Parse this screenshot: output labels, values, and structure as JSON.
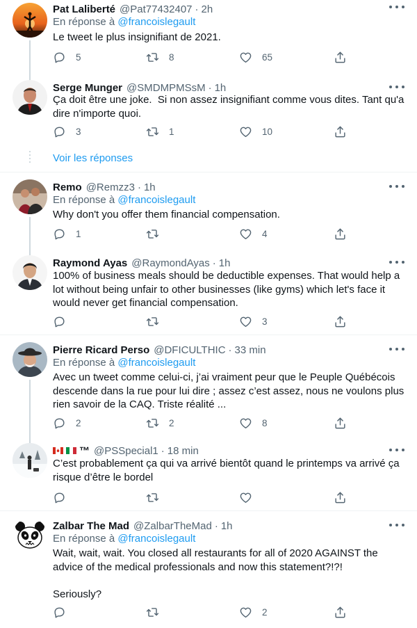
{
  "tweets": [
    {
      "name": "Pat Laliberté",
      "handle": "@Pat77432407",
      "dot": "·",
      "time": "2h",
      "reply_prefix": "En réponse à",
      "reply_mention": "@francoislegault",
      "text": "Le tweet le plus insignifiant de 2021.",
      "replies": "5",
      "retweets": "8",
      "likes": "65"
    },
    {
      "name": "Serge Munger",
      "handle": "@SMDMPMSsM",
      "dot": "·",
      "time": "1h",
      "text": "Ça doit être une joke.  Si non assez insignifiant comme vous dites. Tant qu'a dire n'importe quoi.",
      "replies": "3",
      "retweets": "1",
      "likes": "10"
    },
    {
      "name": "Remo",
      "handle": "@Remzz3",
      "dot": "·",
      "time": "1h",
      "reply_prefix": "En réponse à",
      "reply_mention": "@francoislegault",
      "text": "Why don't you offer them financial compensation.",
      "replies": "1",
      "retweets": "",
      "likes": "4"
    },
    {
      "name": "Raymond Ayas",
      "handle": "@RaymondAyas",
      "dot": "·",
      "time": "1h",
      "text": "100% of business meals should be deductible expenses. That would help a lot without being unfair to other businesses (like gyms) which let's face it would never get financial compensation.",
      "replies": "",
      "retweets": "",
      "likes": "3"
    },
    {
      "name": "Pierre Ricard Perso",
      "handle": "@DFICULTHIC",
      "dot": "·",
      "time": "33 min",
      "reply_prefix": "En réponse à",
      "reply_mention": "@francoislegault",
      "text": "Avec un tweet comme celui-ci, j’ai vraiment peur que le Peuple Québécois descende dans la rue pour lui dire ; assez c’est assez, nous ne voulons plus rien savoir de la CAQ. Triste réalité ...",
      "replies": "2",
      "retweets": "2",
      "likes": "8"
    },
    {
      "name": "™",
      "handle": "@PSSpecial1",
      "dot": "·",
      "time": "18 min",
      "text": "C’est probablement ça qui va arrivé bientôt quand le printemps va arrivé ça risque d’être le bordel",
      "replies": "",
      "retweets": "",
      "likes": ""
    },
    {
      "name": "Zalbar The Mad",
      "handle": "@ZalbarTheMad",
      "dot": "·",
      "time": "1h",
      "reply_prefix": "En réponse à",
      "reply_mention": "@francoislegault",
      "text": "Wait, wait, wait. You closed all restaurants for all of 2020 AGAINST the advice of the medical professionals and now this statement?!?!\n\nSeriously?",
      "replies": "",
      "retweets": "",
      "likes": "2"
    }
  ],
  "see_replies": "Voir les réponses",
  "icons": {
    "reply": "reply-icon",
    "retweet": "retweet-icon",
    "like": "like-icon",
    "share": "share-icon",
    "more": "more-icon"
  },
  "colors": {
    "link": "#1d9bf0",
    "secondary": "#536471",
    "border": "#eff3f4"
  }
}
